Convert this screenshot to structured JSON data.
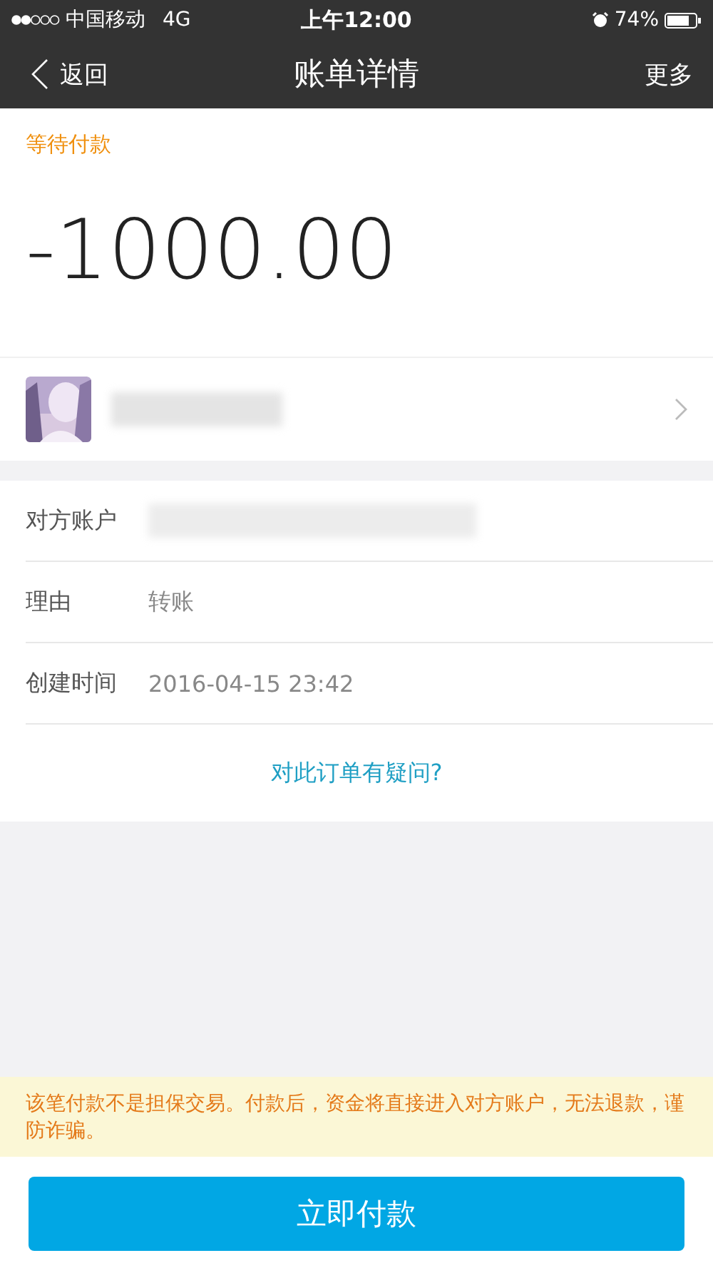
{
  "status_bar": {
    "carrier": "中国移动",
    "network": "4G",
    "time": "上午12:00",
    "battery": "74%"
  },
  "nav": {
    "back": "返回",
    "title": "账单详情",
    "more": "更多"
  },
  "status": "等待付款",
  "amount": "-1000.00",
  "details": [
    {
      "label": "对方账户"
    },
    {
      "label": "理由",
      "value": "转账"
    },
    {
      "label": "创建时间",
      "value": "2016-04-15 23:42"
    }
  ],
  "question_link": "对此订单有疑问?",
  "warning": "该笔付款不是担保交易。付款后，资金将直接进入对方账户，无法退款，谨防诈骗。",
  "pay_button": "立即付款"
}
